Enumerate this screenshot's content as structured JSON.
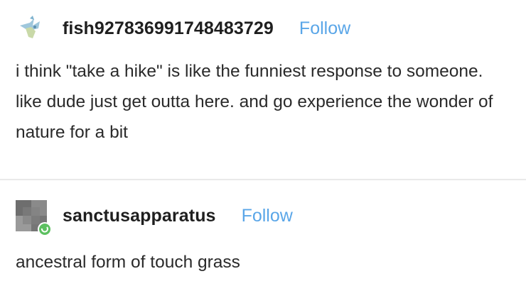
{
  "posts": [
    {
      "username": "fish927836991748483729",
      "follow_label": "Follow",
      "avatar_icon": "fish-avatar-icon",
      "text": "i think \"take a hike\" is like the funniest response to someone. like dude just get outta here. and go experience the wonder of nature for a bit"
    },
    {
      "username": "sanctusapparatus",
      "follow_label": "Follow",
      "avatar_icon": "default-avatar-icon",
      "text": "ancestral form of touch grass"
    }
  ],
  "colors": {
    "follow": "#5aa6e8",
    "username": "#1f1f1f",
    "text": "#2a2a2a",
    "online_dot": "#5cc060"
  }
}
